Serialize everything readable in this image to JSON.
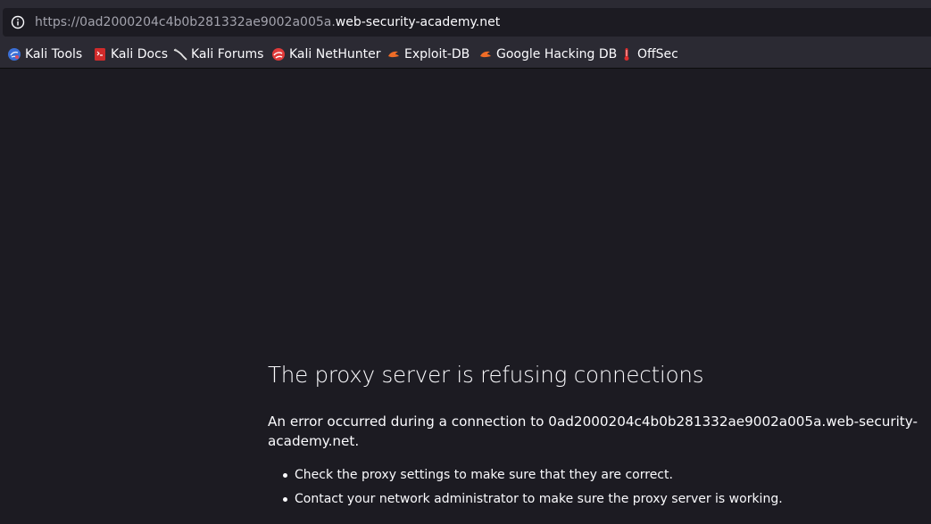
{
  "urlbar": {
    "url_prefix": "https://0ad2000204c4b0b281332ae9002a005a.",
    "url_domain": "web-security-academy.net",
    "info_icon": "info-icon"
  },
  "bookmarks": [
    {
      "label": "Kali Tools",
      "icon": "kali-tools-icon"
    },
    {
      "label": "Kali Docs",
      "icon": "kali-docs-icon"
    },
    {
      "label": "Kali Forums",
      "icon": "kali-forums-icon"
    },
    {
      "label": "Kali NetHunter",
      "icon": "kali-nethunter-icon"
    },
    {
      "label": "Exploit-DB",
      "icon": "exploit-db-icon"
    },
    {
      "label": "Google Hacking DB",
      "icon": "google-hacking-db-icon"
    },
    {
      "label": "OffSec",
      "icon": "offsec-icon"
    }
  ],
  "error": {
    "title": "The proxy server is refusing connections",
    "description": "An error occurred during a connection to 0ad2000204c4b0b281332ae9002a005a.web-security-academy.net.",
    "suggestions": [
      "Check the proxy settings to make sure that they are correct.",
      "Contact your network administrator to make sure the proxy server is working."
    ]
  },
  "colors": {
    "background": "#1c1b22",
    "toolbar": "#2b2a33",
    "text": "#fbfbfe",
    "muted_text": "#a3a3ad"
  }
}
